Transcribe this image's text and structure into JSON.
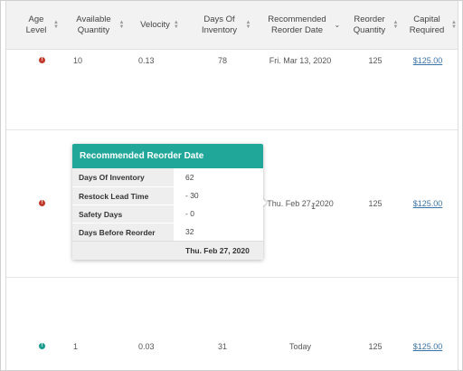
{
  "columns": [
    {
      "label": "Age Level",
      "sort": "both"
    },
    {
      "label": "Available Quantity",
      "sort": "both"
    },
    {
      "label": "Velocity",
      "sort": "both"
    },
    {
      "label": "Days Of Inventory",
      "sort": "both"
    },
    {
      "label": "Recommended Reorder Date",
      "sort": "desc"
    },
    {
      "label": "Reorder Quantity",
      "sort": "both"
    },
    {
      "label": "Capital Required",
      "sort": "both"
    }
  ],
  "rows": [
    {
      "age_status": "alert",
      "age_color": "#c0392b",
      "available": "10",
      "velocity": "0.13",
      "days_of_inventory": "78",
      "reorder_date": "Fri. Mar 13, 2020",
      "reorder_qty": "125",
      "capital": "$125.00"
    },
    {
      "age_status": "alert",
      "age_color": "#c0392b",
      "available": "",
      "velocity": "",
      "days_of_inventory": "",
      "reorder_date": "Thu. Feb 27, 2020",
      "reorder_qty": "125",
      "capital": "$125.00"
    },
    {
      "age_status": "info",
      "age_color": "#1a9c8c",
      "available": "1",
      "velocity": "0.03",
      "days_of_inventory": "31",
      "reorder_date": "Today",
      "reorder_qty": "125",
      "capital": "$125.00"
    }
  ],
  "popover": {
    "title": "Recommended Reorder Date",
    "rows": [
      {
        "label": "Days Of Inventory",
        "value": "62"
      },
      {
        "label": "Restock Lead Time",
        "value": "- 30"
      },
      {
        "label": "Safety Days",
        "value": "- 0"
      },
      {
        "label": "Days Before Reorder",
        "value": "32"
      }
    ],
    "result": "Thu. Feb 27, 2020"
  },
  "colors": {
    "header_bg": "#f2f2f2",
    "popover_header": "#21a79a",
    "link": "#3a73a8",
    "alert": "#c0392b",
    "ok": "#1a9c8c"
  }
}
